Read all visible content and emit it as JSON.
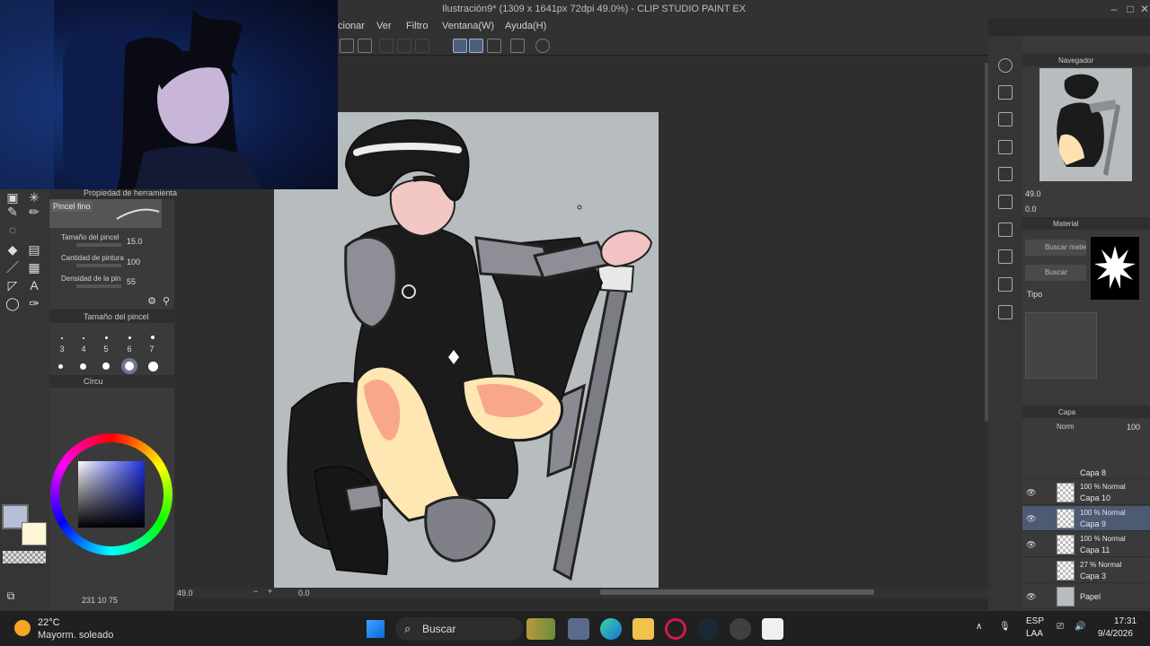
{
  "window": {
    "title": "Ilustración9* (1309 x 1641px 72dpi 49.0%)  - CLIP STUDIO PAINT EX"
  },
  "menu": {
    "items": [
      "cionar",
      "Ver",
      "Filtro",
      "Ventana(W)",
      "Ayuda(H)"
    ]
  },
  "tool_property": {
    "title": "Propiedad de herramienta",
    "brush_name": "Pincel fino",
    "rows": [
      {
        "label": "Tamaño del pincel",
        "value": "15.0"
      },
      {
        "label": "Cantidad de pintura",
        "value": "100"
      },
      {
        "label": "Densidad de la pin",
        "value": "55"
      }
    ]
  },
  "brush_size": {
    "title": "Tamaño del pincel",
    "sizes": [
      "3",
      "4",
      "5",
      "6",
      "7"
    ]
  },
  "color_wheel": {
    "title": "Círcu",
    "status": "231  10  75",
    "main_color": "#b7bfd6",
    "sub_color": "#fff6d6"
  },
  "canvas": {
    "zoom": "49.0",
    "rotation": "0.0",
    "background": "#b7bcbf"
  },
  "navigator": {
    "title": "Navegador",
    "zoom": "49.0",
    "rotation": "0.0"
  },
  "material": {
    "title": "Material",
    "search_material": "Buscar materi",
    "search": "Buscar",
    "type_label": "Tipo"
  },
  "layers": {
    "title": "Capa",
    "blend_mode": "Norm",
    "opacity": "100",
    "rows": [
      {
        "mode": "",
        "name": "Capa 8",
        "visible": false,
        "selected": false
      },
      {
        "mode": "100 % Normal",
        "name": "Capa 10",
        "visible": true,
        "selected": false
      },
      {
        "mode": "100 % Normal",
        "name": "Capa 9",
        "visible": true,
        "selected": true
      },
      {
        "mode": "100 % Normal",
        "name": "Capa 11",
        "visible": true,
        "selected": false
      },
      {
        "mode": "27 % Normal",
        "name": "Capa 3",
        "visible": false,
        "selected": false
      },
      {
        "mode": "",
        "name": "Papel",
        "visible": true,
        "selected": false
      }
    ]
  },
  "taskbar": {
    "weather_temp": "22°C",
    "weather_desc": "Mayorm. soleado",
    "search_label": "Buscar",
    "lang_top": "ESP",
    "lang_bottom": "LAA",
    "time": "17:31",
    "date": "9/4/2026"
  }
}
